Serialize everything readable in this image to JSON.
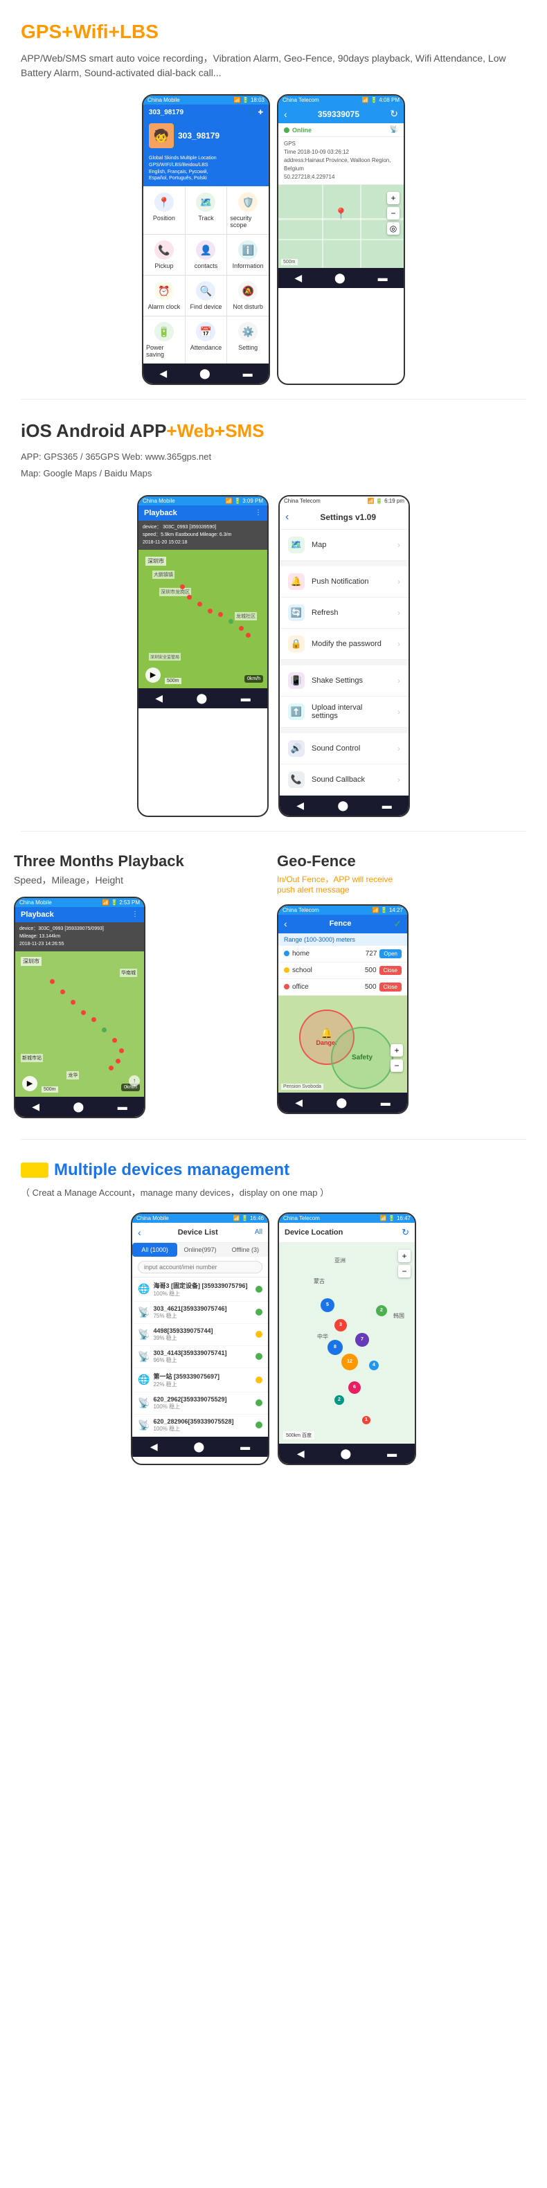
{
  "section1": {
    "title": "GPS+Wifi+LBS",
    "title_color": "#333",
    "highlight": "+Wifi+LBS",
    "description": "APP/Web/SMS smart auto voice recording，Vibration Alarm, Geo-Fence, 90days playback, Wifi Attendance, Low Battery Alarm, Sound-activated dial-back call...",
    "app1": {
      "carrier": "China Mobile",
      "time": "18:03",
      "device_num": "303_98179",
      "tagline_line1": "Global Skinds Multiple Location",
      "tagline_line2": "GPS/WIFI/LBS/Beidou/LBS",
      "tagline_line3": "English, Français, Русский,",
      "tagline_line4": "Español, Português, Polski",
      "menu": [
        {
          "label": "Position",
          "icon": "📍"
        },
        {
          "label": "Track",
          "icon": "🗺️"
        },
        {
          "label": "security scope",
          "icon": "🛡️"
        },
        {
          "label": "Pickup",
          "icon": "📞"
        },
        {
          "label": "contacts",
          "icon": "👤"
        },
        {
          "label": "Information",
          "icon": "ℹ️"
        },
        {
          "label": "Alarm clock",
          "icon": "⏰"
        },
        {
          "label": "Find device",
          "icon": "🔍"
        },
        {
          "label": "Not disturb",
          "icon": "🔕"
        },
        {
          "label": "Power saving",
          "icon": "🔋"
        },
        {
          "label": "Attendance",
          "icon": "📅"
        },
        {
          "label": "Setting",
          "icon": "⚙️"
        }
      ]
    },
    "app2": {
      "carrier": "China Telecom",
      "time": "4:08 PM",
      "device_num": "359339075",
      "status": "Online",
      "gps_info": "GPS",
      "time_info": "Time 2018-10-09 03:26:12",
      "address": "address:Hainaut Province, Walloon Region, Belgium",
      "coords": "50.227218;4.229714"
    }
  },
  "section2": {
    "title": "iOS Android APP",
    "highlight": "+Web+SMS",
    "app_label": "APP:  GPS365 / 365GPS   Web:  www.365gps.net",
    "map_label": "Map: Google Maps / Baidu Maps",
    "playback": {
      "carrier": "China Mobile",
      "time": "3:09 PM",
      "title": "Playback",
      "device": "device： 303C_0993 [359339590]",
      "speed": "speed：5.9km Eastbound Mileage: 6.3/m",
      "date": "2018-11-20 15:02:18",
      "city1": "大鹏镇镇",
      "city2": "深圳市龙岗区",
      "area1": "龙城社区",
      "area2": "深圳安全监管局"
    },
    "settings": {
      "carrier": "China Telecom",
      "time": "6:19 pm",
      "version": "Settings v1.09",
      "items": [
        {
          "label": "Map",
          "icon": "🗺️",
          "color": "#4caf50"
        },
        {
          "label": "Push Notification",
          "icon": "🔔",
          "color": "#f44336"
        },
        {
          "label": "Refresh",
          "icon": "🔄",
          "color": "#2196f3"
        },
        {
          "label": "Modify the password",
          "icon": "🔒",
          "color": "#ff9800"
        },
        {
          "label": "Shake Settings",
          "icon": "📳",
          "color": "#9c27b0"
        },
        {
          "label": "Upload interval settings",
          "icon": "⬆️",
          "color": "#00bcd4"
        },
        {
          "label": "Sound Control",
          "icon": "🔊",
          "color": "#3f51b5"
        },
        {
          "label": "Sound Callback",
          "icon": "📞",
          "color": "#607d8b"
        }
      ]
    }
  },
  "section3": {
    "left": {
      "title": "Three Months Playback",
      "sub": "Speed，Mileage，Height",
      "playback": {
        "carrier": "China Mobile",
        "time": "2:53 PM",
        "title": "Playback",
        "device": "device：303C_0993 [359339075/0993]",
        "mileage": "Mileage: 13.144km",
        "date": "2018-11-23 14:26:55"
      }
    },
    "right": {
      "title": "Geo-Fence",
      "sub_plain": "In/Out Fence，APP will receive",
      "sub_highlight": "push alert message",
      "fence": {
        "carrier": "China Telecom",
        "time": "14:27",
        "title": "Fence",
        "range_label": "Range (100-3000) meters",
        "rows": [
          {
            "place": "home",
            "distance": "727",
            "action": "Open"
          },
          {
            "place": "school",
            "distance": "500",
            "action": "Close"
          },
          {
            "place": "office",
            "distance": "500",
            "action": "Close"
          }
        ],
        "danger_label": "Danger",
        "safety_label": "Safety"
      }
    }
  },
  "section4": {
    "title": "Multiple devices management",
    "sub": "（ Creat a Manage Account，manage many devices，display on one map ）",
    "device_list": {
      "carrier": "China Mobile",
      "time": "16:46",
      "title": "Device List",
      "all_label": "All",
      "tabs": [
        {
          "label": "All (1000)",
          "active": true
        },
        {
          "label": "Online(997)",
          "active": false
        },
        {
          "label": "Offline (3)",
          "active": false
        }
      ],
      "search_placeholder": "input account/imei number",
      "devices": [
        {
          "name": "海哥3 [固定设备] [359339075796]",
          "status": "100% 稳上",
          "online": true
        },
        {
          "name": "303_4621[359339075746]",
          "status": "75% 稳上",
          "online": true
        },
        {
          "name": "4498[359339075744]",
          "status": "39% 稳上",
          "online": true
        },
        {
          "name": "303_4143[359339075741]",
          "status": "96% 稳上",
          "online": true
        },
        {
          "name": "第一站 [359339075697]",
          "status": "22% 稳上",
          "online": true
        },
        {
          "name": "620_2962[359339075529]",
          "status": "100% 稳上",
          "online": true
        },
        {
          "name": "620_282906[359339075528]",
          "status": "100% 稳上",
          "online": true
        }
      ]
    },
    "device_location": {
      "carrier": "China Telecom",
      "time": "16:47",
      "title": "Device Location",
      "regions": [
        "亚洲",
        "蒙古",
        "中华",
        "韩国"
      ],
      "scale": "500km"
    }
  }
}
